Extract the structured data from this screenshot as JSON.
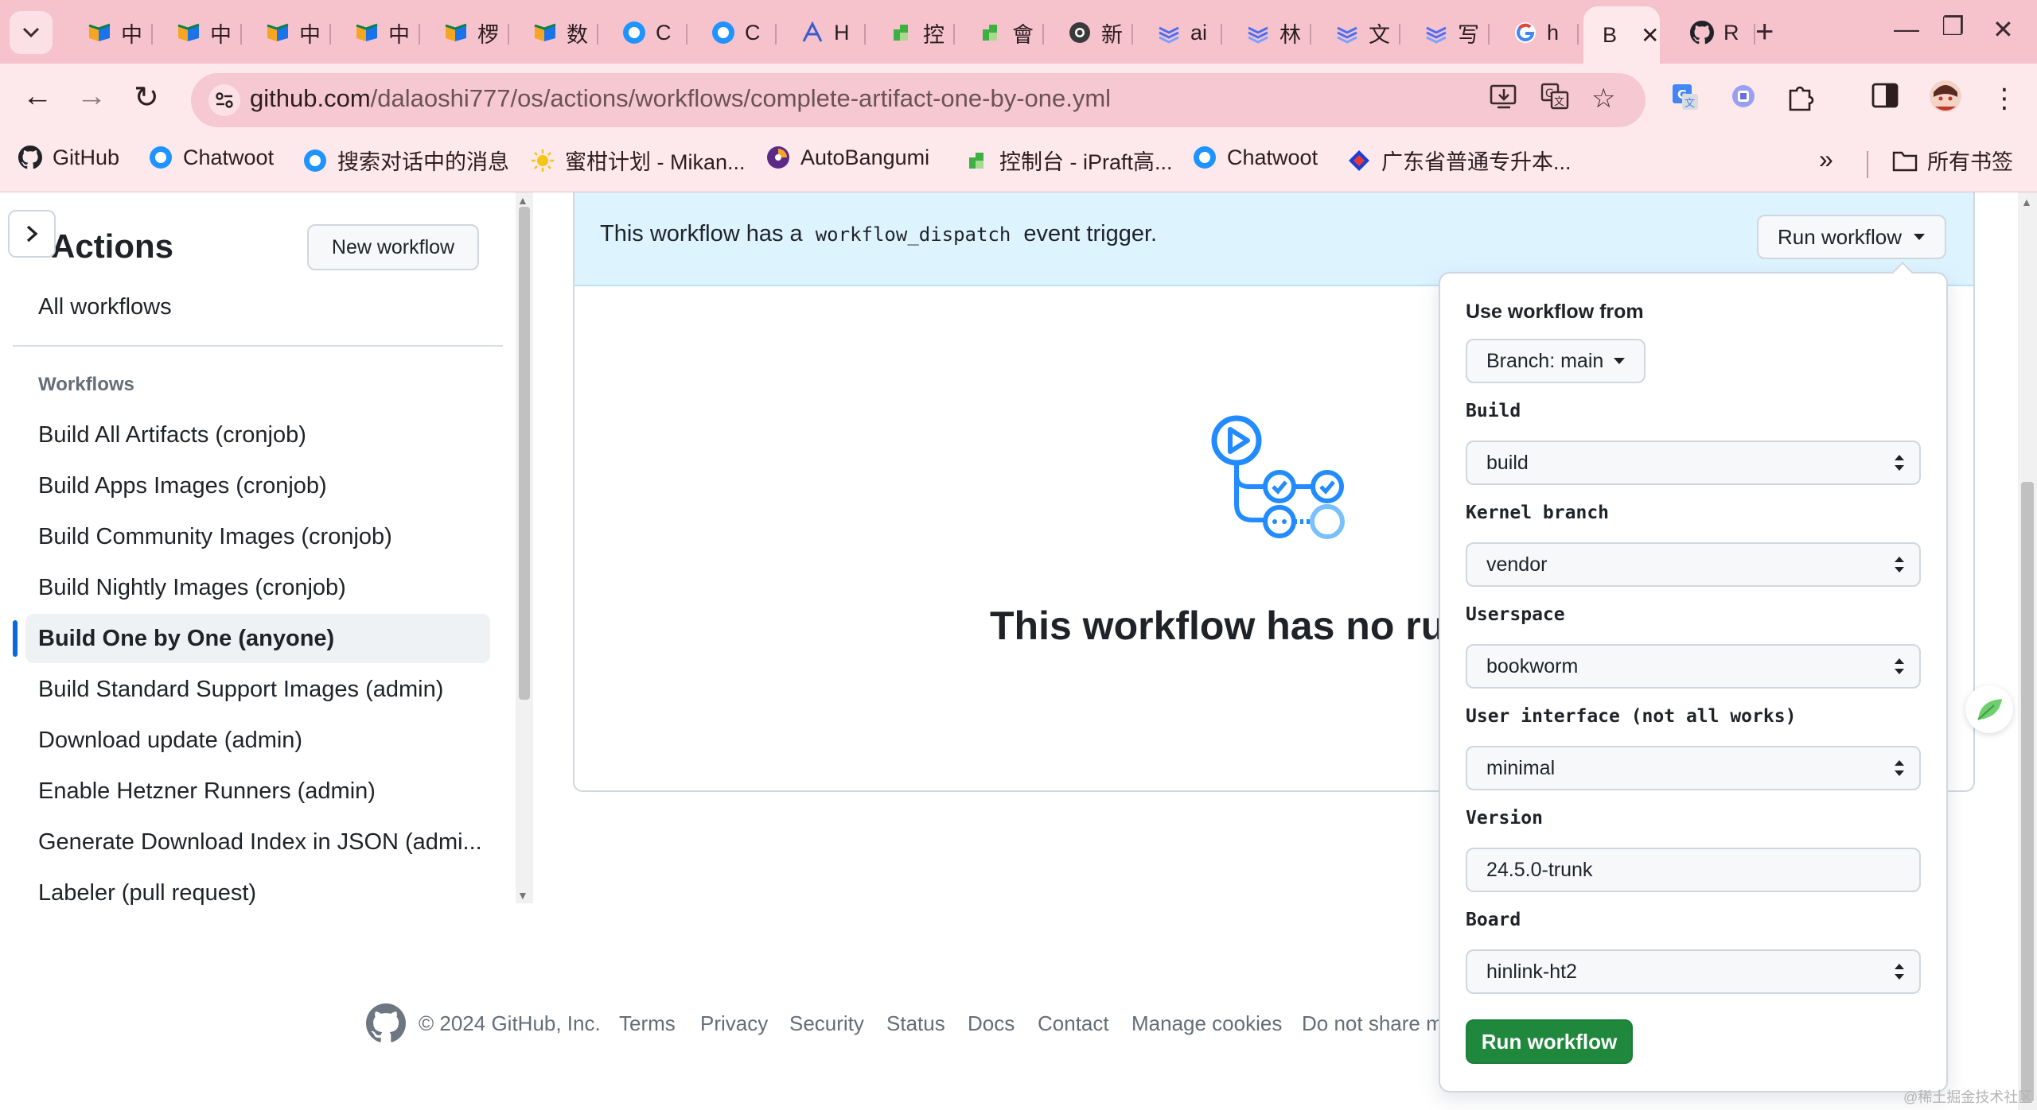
{
  "browser": {
    "tabs": [
      {
        "title": "中",
        "icon": "colored-book-icon",
        "color": "#1a73e8"
      },
      {
        "title": "中",
        "icon": "colored-book-icon",
        "color": "#1a73e8"
      },
      {
        "title": "中",
        "icon": "colored-book-icon",
        "color": "#1a73e8"
      },
      {
        "title": "中",
        "icon": "colored-book-icon",
        "color": "#1a73e8"
      },
      {
        "title": "椤",
        "icon": "colored-book-icon",
        "color": "#1a73e8"
      },
      {
        "title": "数",
        "icon": "colored-book-icon",
        "color": "#1a73e8"
      },
      {
        "title": "C",
        "icon": "chatwoot-icon",
        "color": "#1f93ff"
      },
      {
        "title": "C",
        "icon": "chatwoot-icon",
        "color": "#1f93ff"
      },
      {
        "title": "H",
        "icon": "a-icon",
        "color": "#3a5ccc"
      },
      {
        "title": "控",
        "icon": "green-flag-icon",
        "color": "#3cb043"
      },
      {
        "title": "會",
        "icon": "green-flag-icon",
        "color": "#3cb043"
      },
      {
        "title": "新",
        "icon": "chrome-icon",
        "color": "#3a3a3a"
      },
      {
        "title": "ai",
        "icon": "layers-icon",
        "color": "#4e6ef2"
      },
      {
        "title": "林",
        "icon": "layers-icon",
        "color": "#4e6ef2"
      },
      {
        "title": "文",
        "icon": "layers-icon",
        "color": "#4e6ef2"
      },
      {
        "title": "写",
        "icon": "layers-icon",
        "color": "#4e6ef2"
      },
      {
        "title": "h",
        "icon": "google-icon",
        "color": "#4285f4"
      },
      {
        "title": "B",
        "icon": "none",
        "color": "#2b1d20"
      },
      {
        "title": "R",
        "icon": "github-icon",
        "color": "#1f2328"
      }
    ],
    "url_host": "github.com",
    "url_path": "/dalaoshi777/os/actions/workflows/complete-artifact-one-by-one.yml",
    "bookmarks": [
      {
        "label": "GitHub",
        "icon": "github-icon"
      },
      {
        "label": "Chatwoot",
        "icon": "chatwoot-icon"
      },
      {
        "label": "搜索对话中的消息",
        "icon": "chatwoot-icon"
      },
      {
        "label": "蜜柑计划 - Mikan...",
        "icon": "sun-icon"
      },
      {
        "label": "AutoBangumi",
        "icon": "autobangumi-icon"
      },
      {
        "label": "控制台 - iPraft高...",
        "icon": "green-flag-icon"
      },
      {
        "label": "Chatwoot",
        "icon": "chatwoot-icon"
      },
      {
        "label": "广东省普通专升本...",
        "icon": "diamond-icon"
      }
    ],
    "all_bookmarks": "所有书签"
  },
  "sidebar": {
    "title": "Actions",
    "new_workflow": "New workflow",
    "all_workflows": "All workflows",
    "workflows_heading": "Workflows",
    "items": [
      "Build All Artifacts (cronjob)",
      "Build Apps Images (cronjob)",
      "Build Community Images (cronjob)",
      "Build Nightly Images (cronjob)",
      "Build One by One (anyone)",
      "Build Standard Support Images (admin)",
      "Download update (admin)",
      "Enable Hetzner Runners (admin)",
      "Generate Download Index in JSON (admi...",
      "Labeler (pull request)"
    ],
    "selected_index": 4
  },
  "main": {
    "dispatch_prefix": "This workflow has a",
    "dispatch_code": "workflow_dispatch",
    "dispatch_suffix": "event trigger.",
    "run_workflow_button": "Run workflow",
    "empty_title": "This workflow has no ru"
  },
  "popover": {
    "use_from_label": "Use workflow from",
    "branch_button": "Branch: main",
    "fields": [
      {
        "label": "Build",
        "type": "select",
        "value": "build"
      },
      {
        "label": "Kernel branch",
        "type": "select",
        "value": "vendor"
      },
      {
        "label": "Userspace",
        "type": "select",
        "value": "bookworm"
      },
      {
        "label": "User interface (not all works)",
        "type": "select",
        "value": "minimal"
      },
      {
        "label": "Version",
        "type": "input",
        "value": "24.5.0-trunk"
      },
      {
        "label": "Board",
        "type": "select",
        "value": "hinlink-ht2"
      }
    ],
    "submit": "Run workflow"
  },
  "footer": {
    "copyright": "© 2024 GitHub, Inc.",
    "links": [
      "Terms",
      "Privacy",
      "Security",
      "Status",
      "Docs",
      "Contact",
      "Manage cookies",
      "Do not share m"
    ]
  },
  "watermark": "@稀土掘金技术社区",
  "colors": {
    "tabstrip": "#f6c3cd",
    "toolbar": "#fde8ec",
    "accent_blue": "#0969da",
    "run_green": "#1f883d",
    "dispatch_bg": "#ddf4ff",
    "workflow_icon_blue": "#218bff"
  }
}
